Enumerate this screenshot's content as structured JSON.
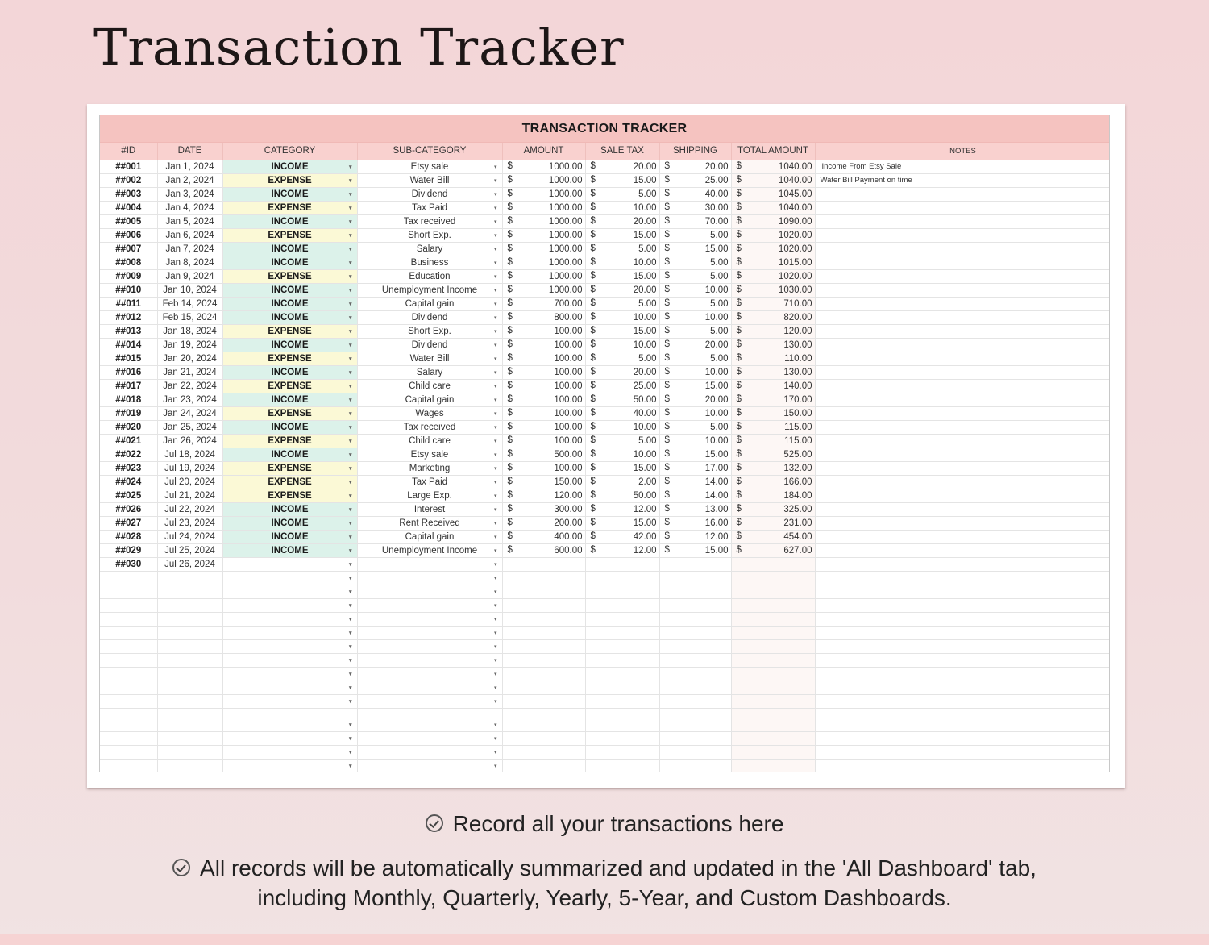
{
  "page": {
    "title": "Transaction Tracker",
    "bullets": [
      "Record all your transactions here",
      "All records will be automatically summarized and updated in the 'All Dashboard' tab,",
      "including Monthly, Quarterly, Yearly, 5-Year, and Custom Dashboards."
    ]
  },
  "sheet": {
    "banner": "TRANSACTION TRACKER",
    "columns": [
      "#ID",
      "DATE",
      "CATEGORY",
      "SUB-CATEGORY",
      "AMOUNT",
      "SALE TAX",
      "SHIPPING",
      "TOTAL AMOUNT",
      "NOTES"
    ],
    "currency_symbol": "$",
    "dropdown_icon": "▾",
    "colors": {
      "income": "#dcf2ea",
      "expense": "#fbf9d6",
      "banner": "#f5c3c0",
      "header": "#f9d1cf"
    },
    "rows": [
      {
        "id": "##001",
        "date": "Jan 1, 2024",
        "category": "INCOME",
        "sub": "Etsy sale",
        "amount": "1000.00",
        "tax": "20.00",
        "ship": "20.00",
        "total": "1040.00",
        "note": "Income From Etsy Sale"
      },
      {
        "id": "##002",
        "date": "Jan 2, 2024",
        "category": "EXPENSE",
        "sub": "Water Bill",
        "amount": "1000.00",
        "tax": "15.00",
        "ship": "25.00",
        "total": "1040.00",
        "note": "Water Bill Payment on time"
      },
      {
        "id": "##003",
        "date": "Jan 3, 2024",
        "category": "INCOME",
        "sub": "Dividend",
        "amount": "1000.00",
        "tax": "5.00",
        "ship": "40.00",
        "total": "1045.00",
        "note": ""
      },
      {
        "id": "##004",
        "date": "Jan 4, 2024",
        "category": "EXPENSE",
        "sub": "Tax Paid",
        "amount": "1000.00",
        "tax": "10.00",
        "ship": "30.00",
        "total": "1040.00",
        "note": ""
      },
      {
        "id": "##005",
        "date": "Jan 5, 2024",
        "category": "INCOME",
        "sub": "Tax received",
        "amount": "1000.00",
        "tax": "20.00",
        "ship": "70.00",
        "total": "1090.00",
        "note": ""
      },
      {
        "id": "##006",
        "date": "Jan 6, 2024",
        "category": "EXPENSE",
        "sub": "Short Exp.",
        "amount": "1000.00",
        "tax": "15.00",
        "ship": "5.00",
        "total": "1020.00",
        "note": ""
      },
      {
        "id": "##007",
        "date": "Jan 7, 2024",
        "category": "INCOME",
        "sub": "Salary",
        "amount": "1000.00",
        "tax": "5.00",
        "ship": "15.00",
        "total": "1020.00",
        "note": ""
      },
      {
        "id": "##008",
        "date": "Jan 8, 2024",
        "category": "INCOME",
        "sub": "Business",
        "amount": "1000.00",
        "tax": "10.00",
        "ship": "5.00",
        "total": "1015.00",
        "note": ""
      },
      {
        "id": "##009",
        "date": "Jan 9, 2024",
        "category": "EXPENSE",
        "sub": "Education",
        "amount": "1000.00",
        "tax": "15.00",
        "ship": "5.00",
        "total": "1020.00",
        "note": ""
      },
      {
        "id": "##010",
        "date": "Jan 10, 2024",
        "category": "INCOME",
        "sub": "Unemployment Income",
        "amount": "1000.00",
        "tax": "20.00",
        "ship": "10.00",
        "total": "1030.00",
        "note": ""
      },
      {
        "id": "##011",
        "date": "Feb 14, 2024",
        "category": "INCOME",
        "sub": "Capital gain",
        "amount": "700.00",
        "tax": "5.00",
        "ship": "5.00",
        "total": "710.00",
        "note": ""
      },
      {
        "id": "##012",
        "date": "Feb 15, 2024",
        "category": "INCOME",
        "sub": "Dividend",
        "amount": "800.00",
        "tax": "10.00",
        "ship": "10.00",
        "total": "820.00",
        "note": ""
      },
      {
        "id": "##013",
        "date": "Jan 18, 2024",
        "category": "EXPENSE",
        "sub": "Short Exp.",
        "amount": "100.00",
        "tax": "15.00",
        "ship": "5.00",
        "total": "120.00",
        "note": ""
      },
      {
        "id": "##014",
        "date": "Jan 19, 2024",
        "category": "INCOME",
        "sub": "Dividend",
        "amount": "100.00",
        "tax": "10.00",
        "ship": "20.00",
        "total": "130.00",
        "note": ""
      },
      {
        "id": "##015",
        "date": "Jan 20, 2024",
        "category": "EXPENSE",
        "sub": "Water Bill",
        "amount": "100.00",
        "tax": "5.00",
        "ship": "5.00",
        "total": "110.00",
        "note": ""
      },
      {
        "id": "##016",
        "date": "Jan 21, 2024",
        "category": "INCOME",
        "sub": "Salary",
        "amount": "100.00",
        "tax": "20.00",
        "ship": "10.00",
        "total": "130.00",
        "note": ""
      },
      {
        "id": "##017",
        "date": "Jan 22, 2024",
        "category": "EXPENSE",
        "sub": "Child care",
        "amount": "100.00",
        "tax": "25.00",
        "ship": "15.00",
        "total": "140.00",
        "note": ""
      },
      {
        "id": "##018",
        "date": "Jan 23, 2024",
        "category": "INCOME",
        "sub": "Capital gain",
        "amount": "100.00",
        "tax": "50.00",
        "ship": "20.00",
        "total": "170.00",
        "note": ""
      },
      {
        "id": "##019",
        "date": "Jan 24, 2024",
        "category": "EXPENSE",
        "sub": "Wages",
        "amount": "100.00",
        "tax": "40.00",
        "ship": "10.00",
        "total": "150.00",
        "note": ""
      },
      {
        "id": "##020",
        "date": "Jan 25, 2024",
        "category": "INCOME",
        "sub": "Tax received",
        "amount": "100.00",
        "tax": "10.00",
        "ship": "5.00",
        "total": "115.00",
        "note": ""
      },
      {
        "id": "##021",
        "date": "Jan 26, 2024",
        "category": "EXPENSE",
        "sub": "Child care",
        "amount": "100.00",
        "tax": "5.00",
        "ship": "10.00",
        "total": "115.00",
        "note": ""
      },
      {
        "id": "##022",
        "date": "Jul 18, 2024",
        "category": "INCOME",
        "sub": "Etsy sale",
        "amount": "500.00",
        "tax": "10.00",
        "ship": "15.00",
        "total": "525.00",
        "note": ""
      },
      {
        "id": "##023",
        "date": "Jul 19, 2024",
        "category": "EXPENSE",
        "sub": "Marketing",
        "amount": "100.00",
        "tax": "15.00",
        "ship": "17.00",
        "total": "132.00",
        "note": ""
      },
      {
        "id": "##024",
        "date": "Jul 20, 2024",
        "category": "EXPENSE",
        "sub": "Tax Paid",
        "amount": "150.00",
        "tax": "2.00",
        "ship": "14.00",
        "total": "166.00",
        "note": ""
      },
      {
        "id": "##025",
        "date": "Jul 21, 2024",
        "category": "EXPENSE",
        "sub": "Large Exp.",
        "amount": "120.00",
        "tax": "50.00",
        "ship": "14.00",
        "total": "184.00",
        "note": ""
      },
      {
        "id": "##026",
        "date": "Jul 22, 2024",
        "category": "INCOME",
        "sub": "Interest",
        "amount": "300.00",
        "tax": "12.00",
        "ship": "13.00",
        "total": "325.00",
        "note": ""
      },
      {
        "id": "##027",
        "date": "Jul 23, 2024",
        "category": "INCOME",
        "sub": "Rent Received",
        "amount": "200.00",
        "tax": "15.00",
        "ship": "16.00",
        "total": "231.00",
        "note": ""
      },
      {
        "id": "##028",
        "date": "Jul 24, 2024",
        "category": "INCOME",
        "sub": "Capital gain",
        "amount": "400.00",
        "tax": "42.00",
        "ship": "12.00",
        "total": "454.00",
        "note": ""
      },
      {
        "id": "##029",
        "date": "Jul 25, 2024",
        "category": "INCOME",
        "sub": "Unemployment Income",
        "amount": "600.00",
        "tax": "12.00",
        "ship": "15.00",
        "total": "627.00",
        "note": ""
      },
      {
        "id": "##030",
        "date": "Jul 26, 2024",
        "category": "",
        "sub": "",
        "amount": "",
        "tax": "",
        "ship": "",
        "total": "",
        "note": ""
      }
    ],
    "empty_rows_before_gap": 10,
    "empty_rows_after_gap": 4
  }
}
